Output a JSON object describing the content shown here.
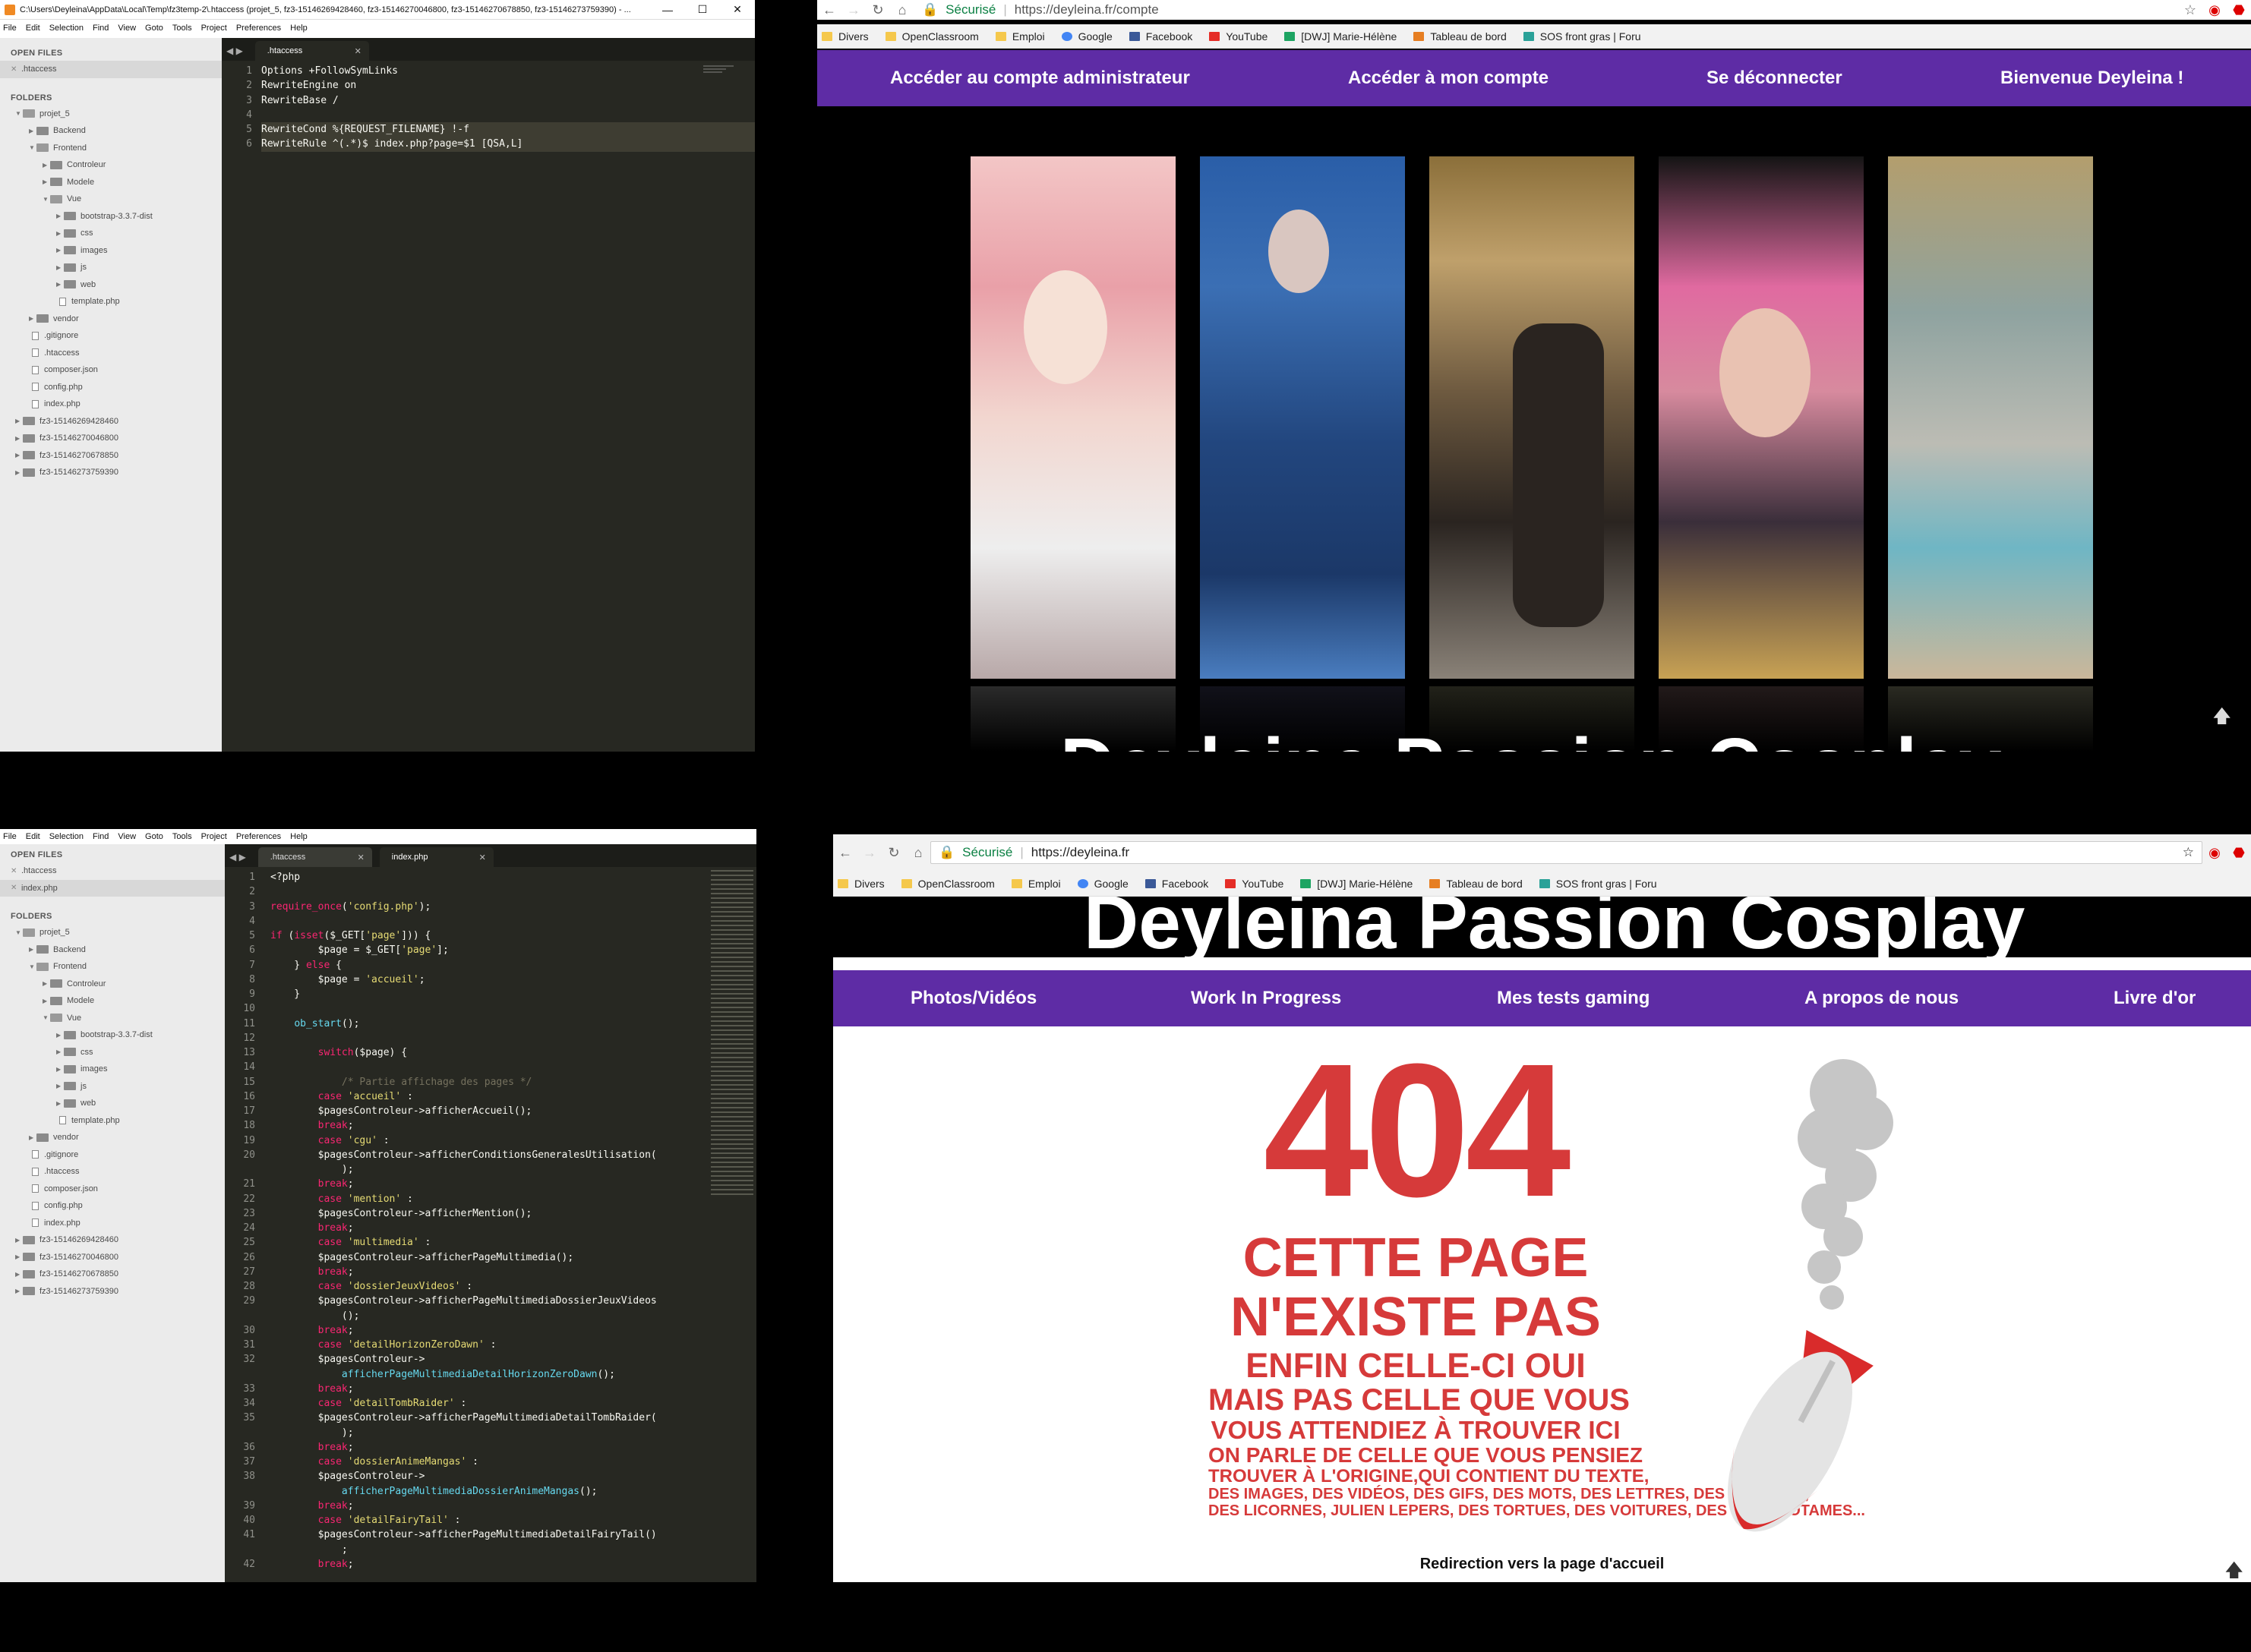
{
  "top_left_editor": {
    "window_title": "C:\\Users\\Deyleina\\AppData\\Local\\Temp\\fz3temp-2\\.htaccess (projet_5, fz3-15146269428460, fz3-15146270046800, fz3-15146270678850, fz3-15146273759390) - ...",
    "menu": [
      "File",
      "Edit",
      "Selection",
      "Find",
      "View",
      "Goto",
      "Tools",
      "Project",
      "Preferences",
      "Help"
    ],
    "open_files_header": "OPEN FILES",
    "open_files": [
      ".htaccess"
    ],
    "folders_header": "FOLDERS",
    "tree": [
      {
        "label": "projet_5",
        "type": "folder-open",
        "depth": 0
      },
      {
        "label": "Backend",
        "type": "folder",
        "depth": 1
      },
      {
        "label": "Frontend",
        "type": "folder-open",
        "depth": 1
      },
      {
        "label": "Controleur",
        "type": "folder",
        "depth": 2
      },
      {
        "label": "Modele",
        "type": "folder",
        "depth": 2
      },
      {
        "label": "Vue",
        "type": "folder-open",
        "depth": 2
      },
      {
        "label": "bootstrap-3.3.7-dist",
        "type": "folder",
        "depth": 3
      },
      {
        "label": "css",
        "type": "folder",
        "depth": 3
      },
      {
        "label": "images",
        "type": "folder",
        "depth": 3
      },
      {
        "label": "js",
        "type": "folder",
        "depth": 3
      },
      {
        "label": "web",
        "type": "folder",
        "depth": 3
      },
      {
        "label": "template.php",
        "type": "file",
        "depth": 3
      },
      {
        "label": "vendor",
        "type": "folder",
        "depth": 1
      },
      {
        "label": ".gitignore",
        "type": "file",
        "depth": 1
      },
      {
        "label": ".htaccess",
        "type": "file",
        "depth": 1
      },
      {
        "label": "composer.json",
        "type": "file",
        "depth": 1
      },
      {
        "label": "config.php",
        "type": "file",
        "depth": 1
      },
      {
        "label": "index.php",
        "type": "file",
        "depth": 1
      },
      {
        "label": "fz3-15146269428460",
        "type": "folder",
        "depth": 0
      },
      {
        "label": "fz3-15146270046800",
        "type": "folder",
        "depth": 0
      },
      {
        "label": "fz3-15146270678850",
        "type": "folder",
        "depth": 0
      },
      {
        "label": "fz3-15146273759390",
        "type": "folder",
        "depth": 0
      }
    ],
    "tabs": [
      ".htaccess"
    ],
    "lines": [
      "Options +FollowSymLinks",
      "RewriteEngine on",
      "RewriteBase /",
      "",
      "RewriteCond %{REQUEST_FILENAME} !-f",
      "RewriteRule ^(.*)$ index.php?page=$1 [QSA,L]"
    ]
  },
  "top_right_browser": {
    "secure_label": "Sécurisé",
    "url": "https://deyleina.fr/compte",
    "bookmarks": [
      "Divers",
      "OpenClassroom",
      "Emploi",
      "Google",
      "Facebook",
      "YouTube",
      "[DWJ] Marie-Hélène",
      "Tableau de bord",
      "SOS front gras | Foru"
    ],
    "nav": [
      "Accéder au compte administrateur",
      "Accéder à mon compte",
      "Se déconnecter",
      "Bienvenue Deyleina !"
    ],
    "site_title": "Deyleina Passion Cosplay"
  },
  "bottom_left_editor": {
    "menu": [
      "File",
      "Edit",
      "Selection",
      "Find",
      "View",
      "Goto",
      "Tools",
      "Project",
      "Preferences",
      "Help"
    ],
    "open_files_header": "OPEN FILES",
    "open_files": [
      ".htaccess",
      "index.php"
    ],
    "folders_header": "FOLDERS",
    "tree": [
      {
        "label": "projet_5",
        "type": "folder-open",
        "depth": 0
      },
      {
        "label": "Backend",
        "type": "folder",
        "depth": 1
      },
      {
        "label": "Frontend",
        "type": "folder-open",
        "depth": 1
      },
      {
        "label": "Controleur",
        "type": "folder",
        "depth": 2
      },
      {
        "label": "Modele",
        "type": "folder",
        "depth": 2
      },
      {
        "label": "Vue",
        "type": "folder-open",
        "depth": 2
      },
      {
        "label": "bootstrap-3.3.7-dist",
        "type": "folder",
        "depth": 3
      },
      {
        "label": "css",
        "type": "folder",
        "depth": 3
      },
      {
        "label": "images",
        "type": "folder",
        "depth": 3
      },
      {
        "label": "js",
        "type": "folder",
        "depth": 3
      },
      {
        "label": "web",
        "type": "folder",
        "depth": 3
      },
      {
        "label": "template.php",
        "type": "file",
        "depth": 3
      },
      {
        "label": "vendor",
        "type": "folder",
        "depth": 1
      },
      {
        "label": ".gitignore",
        "type": "file",
        "depth": 1
      },
      {
        "label": ".htaccess",
        "type": "file",
        "depth": 1
      },
      {
        "label": "composer.json",
        "type": "file",
        "depth": 1
      },
      {
        "label": "config.php",
        "type": "file",
        "depth": 1
      },
      {
        "label": "index.php",
        "type": "file",
        "depth": 1
      },
      {
        "label": "fz3-15146269428460",
        "type": "folder",
        "depth": 0
      },
      {
        "label": "fz3-15146270046800",
        "type": "folder",
        "depth": 0
      },
      {
        "label": "fz3-15146270678850",
        "type": "folder",
        "depth": 0
      },
      {
        "label": "fz3-15146273759390",
        "type": "folder",
        "depth": 0
      }
    ],
    "tabs": [
      ".htaccess",
      "index.php"
    ],
    "line_numbers": [
      "1",
      "2",
      "3",
      "4",
      "5",
      "6",
      "7",
      "8",
      "9",
      "10",
      "11",
      "12",
      "13",
      "14",
      "15",
      "16",
      "17",
      "18",
      "19",
      "20",
      "",
      "21",
      "22",
      "23",
      "24",
      "25",
      "26",
      "27",
      "28",
      "29",
      "",
      "30",
      "31",
      "32",
      "",
      "33",
      "34",
      "35",
      "",
      "36",
      "37",
      "38",
      "",
      "39",
      "40",
      "41",
      "",
      "42"
    ],
    "lines": [
      "<?php",
      "",
      "require_once('config.php');",
      "",
      "if (isset($_GET['page'])) {",
      "        $page = $_GET['page'];",
      "    } else {",
      "        $page = 'accueil';",
      "    }",
      "",
      "    ob_start();",
      "",
      "        switch($page) {",
      "",
      "            /* Partie affichage des pages */",
      "        case 'accueil' :",
      "        $pagesControleur->afficherAccueil();",
      "        break;",
      "        case 'cgu' :",
      "        $pagesControleur->afficherConditionsGeneralesUtilisation(",
      "            );",
      "        break;",
      "        case 'mention' :",
      "        $pagesControleur->afficherMention();",
      "        break;",
      "        case 'multimedia' :",
      "        $pagesControleur->afficherPageMultimedia();",
      "        break;",
      "        case 'dossierJeuxVideos' :",
      "        $pagesControleur->afficherPageMultimediaDossierJeuxVideos",
      "            ();",
      "        break;",
      "        case 'detailHorizonZeroDawn' :",
      "        $pagesControleur->",
      "            afficherPageMultimediaDetailHorizonZeroDawn();",
      "        break;",
      "        case 'detailTombRaider' :",
      "        $pagesControleur->afficherPageMultimediaDetailTombRaider(",
      "            );",
      "        break;",
      "        case 'dossierAnimeMangas' :",
      "        $pagesControleur->",
      "            afficherPageMultimediaDossierAnimeMangas();",
      "        break;",
      "        case 'detailFairyTail' :",
      "        $pagesControleur->afficherPageMultimediaDetailFairyTail()",
      "            ;",
      "        break;"
    ]
  },
  "bottom_right_browser": {
    "secure_label": "Sécurisé",
    "url": "https://deyleina.fr",
    "bookmarks": [
      "Divers",
      "OpenClassroom",
      "Emploi",
      "Google",
      "Facebook",
      "YouTube",
      "[DWJ] Marie-Hélène",
      "Tableau de bord",
      "SOS front gras | Foru"
    ],
    "site_title": "Deyleina Passion Cosplay",
    "nav": [
      "Photos/Vidéos",
      "Work In Progress",
      "Mes tests gaming",
      "A propos de nous",
      "Livre d'or"
    ],
    "error_code": "404",
    "error_lines": [
      "CETTE PAGE",
      "N'EXISTE PAS",
      "ENFIN CELLE-CI OUI",
      "MAIS PAS CELLE QUE VOUS",
      "VOUS ATTENDIEZ À TROUVER ICI",
      "ON PARLE DE CELLE QUE VOUS PENSIEZ",
      "TROUVER À L'ORIGINE,QUI CONTIENT DU TEXTE,",
      "DES IMAGES, DES VIDÉOS, DES GIFS, DES MOTS, DES LETTRES, DES CHIFFRES,",
      "DES LICORNES, JULIEN LEPERS, DES TORTUES, DES VOITURES, DES HIPPOPOTAMES..."
    ],
    "redirect_text": "Redirection vers la page d'accueil"
  },
  "colors": {
    "accent": "#5e2ca5",
    "error_red": "#d63a3a",
    "editor_bg": "#272822"
  },
  "icons": [
    "back-arrow-icon",
    "forward-arrow-icon",
    "reload-icon",
    "home-icon",
    "lock-icon",
    "star-icon",
    "opera-icon",
    "adblock-icon",
    "scroll-top-icon",
    "bomb-illustration",
    "folder-icon",
    "file-icon"
  ]
}
